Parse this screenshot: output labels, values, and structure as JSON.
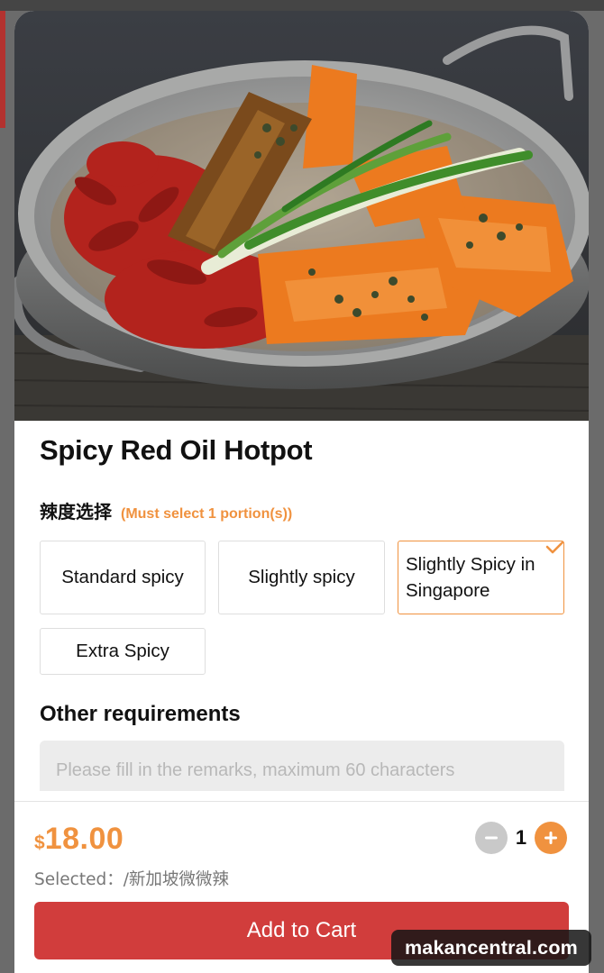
{
  "product": {
    "title": "Spicy Red Oil Hotpot",
    "image_alt": "Spicy red oil hotpot with dried chillies, peppercorns and spring onions in a metal pan"
  },
  "spice_section": {
    "label": "辣度选择",
    "hint": "(Must select 1 portion(s))",
    "options": [
      {
        "label": "Standard spicy",
        "selected": false
      },
      {
        "label": "Slightly spicy",
        "selected": false
      },
      {
        "label": "Slightly Spicy in Singapore",
        "selected": true
      },
      {
        "label": "Extra Spicy",
        "selected": false
      }
    ]
  },
  "other_requirements": {
    "title": "Other requirements",
    "placeholder": "Please fill in the remarks, maximum 60 characters",
    "value": ""
  },
  "footer": {
    "currency": "$",
    "price": "18.00",
    "selected_text": "Selected：/新加坡微微辣",
    "quantity": "1",
    "add_to_cart_label": "Add to Cart"
  },
  "watermark": "makancentral.com",
  "icons": {
    "minus": "minus-circle-icon",
    "plus": "plus-circle-icon",
    "check": "check-corner-icon"
  },
  "colors": {
    "accent_orange": "#f0923f",
    "cart_red": "#d13d3c",
    "minus_gray": "#c9c9c9"
  }
}
